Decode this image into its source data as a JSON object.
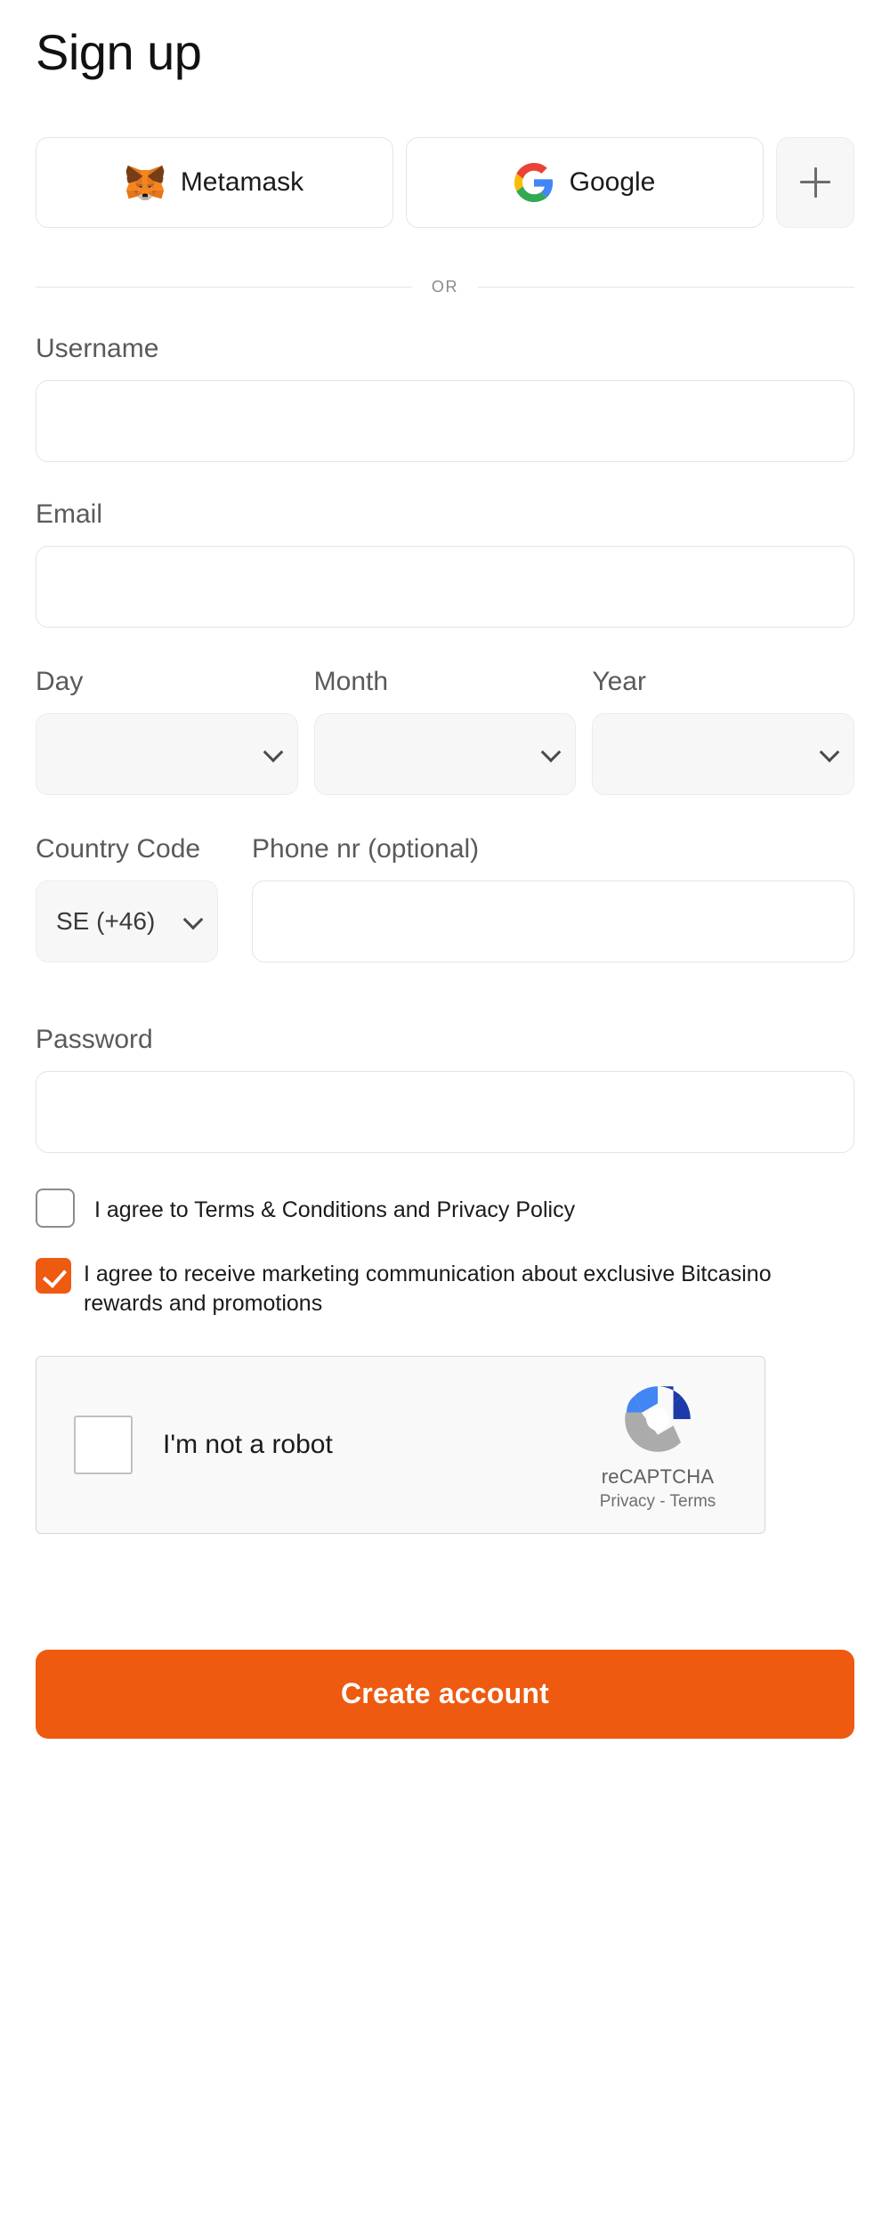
{
  "page": {
    "title": "Sign up"
  },
  "social": {
    "metamask": {
      "label": "Metamask",
      "icon": "metamask-fox-icon"
    },
    "google": {
      "label": "Google",
      "icon": "google-g-icon"
    },
    "more": {
      "label": "+",
      "icon": "plus-icon"
    }
  },
  "divider": {
    "text": "OR"
  },
  "form": {
    "username": {
      "label": "Username",
      "value": "",
      "placeholder": ""
    },
    "email": {
      "label": "Email",
      "value": "",
      "placeholder": ""
    },
    "day": {
      "label": "Day",
      "value": "",
      "placeholder": ""
    },
    "month": {
      "label": "Month",
      "value": "",
      "placeholder": ""
    },
    "year": {
      "label": "Year",
      "value": "",
      "placeholder": ""
    },
    "country_code": {
      "label": "Country Code",
      "value": "SE (+46)"
    },
    "phone": {
      "label": "Phone nr (optional)",
      "value": "",
      "placeholder": ""
    },
    "password": {
      "label": "Password",
      "value": "",
      "placeholder": ""
    }
  },
  "consents": {
    "terms": {
      "label": "I agree to Terms & Conditions and Privacy Policy",
      "checked": false
    },
    "marketing": {
      "label": "I agree to receive marketing communication about exclusive Bitcasino rewards and promotions",
      "checked": true
    }
  },
  "recaptcha": {
    "label": "I'm not a robot",
    "brand": "reCAPTCHA",
    "links": "Privacy - Terms",
    "checked": false
  },
  "submit": {
    "label": "Create account"
  },
  "colors": {
    "accent": "#EE5A10",
    "label_text": "#5a5a5a",
    "border": "#e4e4e4",
    "select_bg": "#f7f7f7"
  }
}
